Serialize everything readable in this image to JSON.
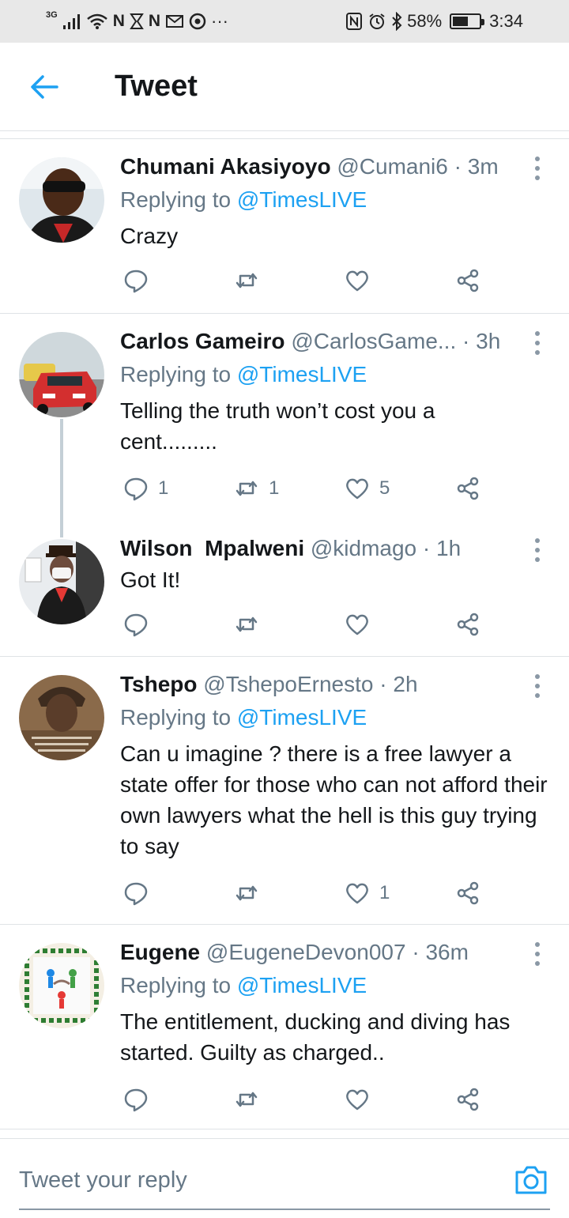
{
  "status_bar": {
    "network": "3G",
    "left_icons": [
      "signal-bars-icon",
      "wifi-icon",
      "N",
      "hourglass-icon",
      "N",
      "gmail-icon",
      "chrome-icon",
      "···"
    ],
    "battery": "58%",
    "battery_level": 0.58,
    "time": "3:34"
  },
  "header": {
    "title": "Tweet"
  },
  "tweets": [
    {
      "name": "Chumani Akasiyoyo",
      "handle": "@Cumani6",
      "time": "3m",
      "replying_prefix": "Replying to",
      "replying_to": "@TimesLIVE",
      "text": "Crazy",
      "replies": "",
      "retweets": "",
      "likes": ""
    },
    {
      "name": "Carlos Gameiro",
      "handle": "@CarlosGame...",
      "time": "3h",
      "replying_prefix": "Replying to",
      "replying_to": "@TimesLIVE",
      "text": "Telling the truth won’t cost you a cent.........",
      "replies": "1",
      "retweets": "1",
      "likes": "5"
    },
    {
      "name": "Wilson  Mpalweni",
      "handle": "@kidmago",
      "time": "1h",
      "text": "Got It!",
      "replies": "",
      "retweets": "",
      "likes": ""
    },
    {
      "name": "Tshepo",
      "handle": "@TshepoErnesto",
      "time": "2h",
      "replying_prefix": "Replying to",
      "replying_to": "@TimesLIVE",
      "text": "Can u imagine ? there is a free lawyer a state offer for those who can not afford their own lawyers what the hell is this guy trying to say",
      "replies": "",
      "retweets": "",
      "likes": "1"
    },
    {
      "name": "Eugene",
      "handle": "@EugeneDevon007",
      "time": "36m",
      "replying_prefix": "Replying to",
      "replying_to": "@TimesLIVE",
      "text": "The entitlement, ducking and diving has started. Guilty as charged..",
      "replies": "",
      "retweets": "",
      "likes": ""
    }
  ],
  "reply_bar": {
    "placeholder": "Tweet your reply"
  },
  "colors": {
    "accent": "#1da1f2",
    "text_primary": "#14171a",
    "text_secondary": "#657786",
    "divider": "#dfe3e6"
  }
}
